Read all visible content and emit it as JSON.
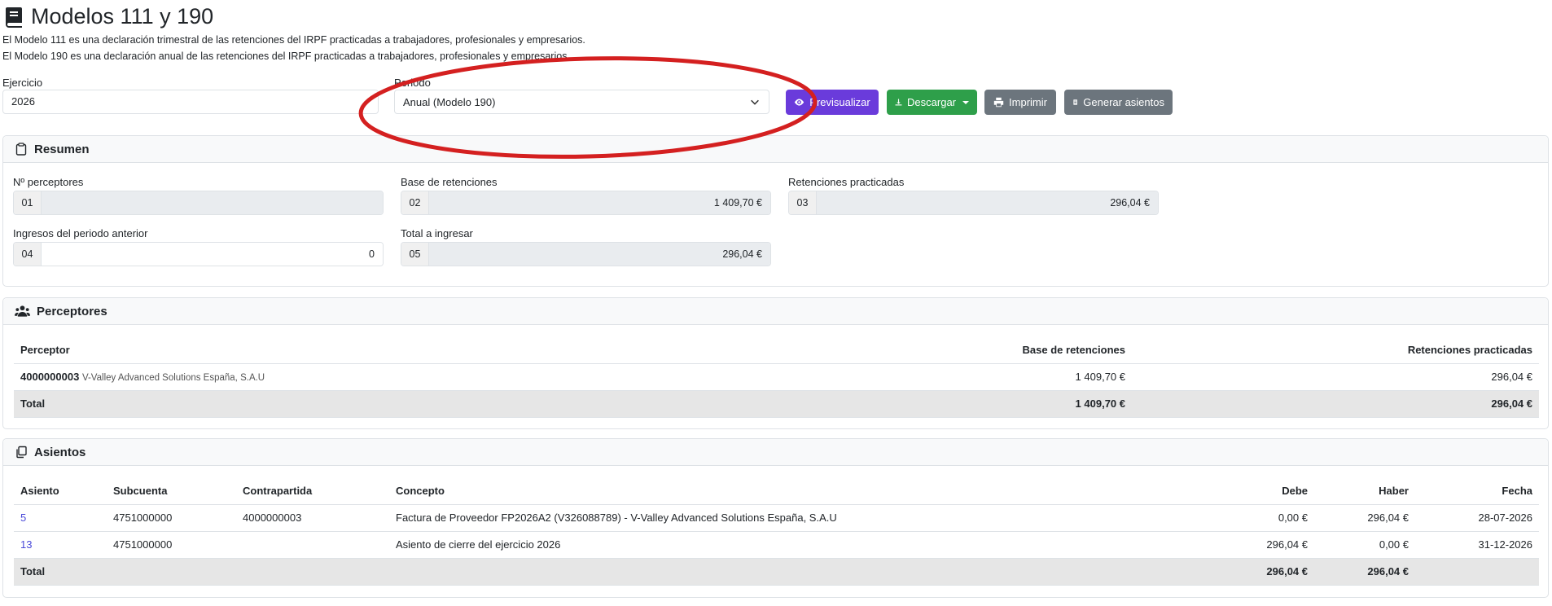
{
  "header": {
    "title": "Modelos 111 y 190",
    "desc_111": "El Modelo 111 es una declaración trimestral de las retenciones del IRPF practicadas a trabajadores, profesionales y empresarios.",
    "desc_190": "El Modelo 190 es una declaración anual de las retenciones del IRPF practicadas a trabajadores, profesionales y empresarios."
  },
  "controls": {
    "ejercicio_label": "Ejercicio",
    "ejercicio_value": "2026",
    "periodo_label": "Periodo",
    "periodo_value": "Anual (Modelo 190)",
    "btn_preview": "Previsualizar",
    "btn_download": "Descargar",
    "btn_print": "Imprimir",
    "btn_generate": "Generar asientos"
  },
  "resumen": {
    "title": "Resumen",
    "fields": [
      {
        "label": "Nº perceptores",
        "code": "01",
        "value": ""
      },
      {
        "label": "Base de retenciones",
        "code": "02",
        "value": "1 409,70 €"
      },
      {
        "label": "Retenciones practicadas",
        "code": "03",
        "value": "296,04 €"
      },
      {
        "label": "Ingresos del periodo anterior",
        "code": "04",
        "value": "0"
      },
      {
        "label": "Total a ingresar",
        "code": "05",
        "value": "296,04 €"
      }
    ]
  },
  "perceptores": {
    "title": "Perceptores",
    "columns": [
      "Perceptor",
      "Base de retenciones",
      "Retenciones practicadas"
    ],
    "rows": [
      {
        "code": "4000000003",
        "name": "V-Valley Advanced Solutions España, S.A.U",
        "base": "1 409,70 €",
        "ret": "296,04 €"
      }
    ],
    "total": {
      "label": "Total",
      "base": "1 409,70 €",
      "ret": "296,04 €"
    }
  },
  "asientos": {
    "title": "Asientos",
    "columns": [
      "Asiento",
      "Subcuenta",
      "Contrapartida",
      "Concepto",
      "Debe",
      "Haber",
      "Fecha"
    ],
    "rows": [
      {
        "asiento": "5",
        "subcuenta": "4751000000",
        "contrapartida": "4000000003",
        "concepto": "Factura de Proveedor FP2026A2 (V326088789) - V-Valley Advanced Solutions España, S.A.U",
        "debe": "0,00 €",
        "haber": "296,04 €",
        "fecha": "28-07-2026"
      },
      {
        "asiento": "13",
        "subcuenta": "4751000000",
        "contrapartida": "",
        "concepto": "Asiento de cierre del ejercicio 2026",
        "debe": "296,04 €",
        "haber": "0,00 €",
        "fecha": "31-12-2026"
      }
    ],
    "total": {
      "label": "Total",
      "debe": "296,04 €",
      "haber": "296,04 €"
    }
  },
  "colors": {
    "preview": "#6a3bdb",
    "download": "#2e9f4a",
    "secondary": "#6c757d",
    "annotation": "#d42020"
  }
}
